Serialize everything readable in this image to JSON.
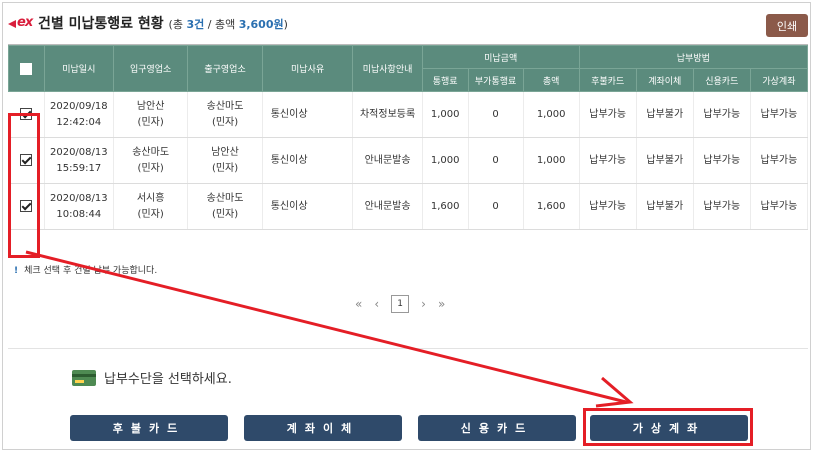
{
  "header": {
    "title": "건별 미납통행료 현황",
    "summary_prefix": "(총 ",
    "count": "3건",
    "summary_mid": " / 총액 ",
    "total": "3,600원",
    "summary_suffix": ")",
    "print_label": "인쇄"
  },
  "table": {
    "headers": {
      "date": "미납일시",
      "entry": "입구영업소",
      "exit": "출구영업소",
      "reason": "미납사유",
      "guide": "미납사항안내",
      "amount_group": "미납금액",
      "method_group": "납부방법",
      "toll": "통행료",
      "surcharge": "부가통행료",
      "total": "총액",
      "postpaid": "후불카드",
      "transfer": "계좌이체",
      "credit": "신용카드",
      "virtual": "가상계좌"
    },
    "rows": [
      {
        "date": "2020/09/18",
        "time": "12:42:04",
        "entry": "남안산",
        "entry_sub": "(민자)",
        "exit": "송산마도",
        "exit_sub": "(민자)",
        "reason": "통신이상",
        "guide": "차적정보등록",
        "toll": "1,000",
        "surcharge": "0",
        "total": "1,000",
        "postpaid": "납부가능",
        "transfer": "납부불가",
        "credit": "납부가능",
        "virtual": "납부가능",
        "checked": true
      },
      {
        "date": "2020/08/13",
        "time": "15:59:17",
        "entry": "송산마도",
        "entry_sub": "(민자)",
        "exit": "남안산",
        "exit_sub": "(민자)",
        "reason": "통신이상",
        "guide": "안내문발송",
        "toll": "1,000",
        "surcharge": "0",
        "total": "1,000",
        "postpaid": "납부가능",
        "transfer": "납부불가",
        "credit": "납부가능",
        "virtual": "납부가능",
        "checked": true
      },
      {
        "date": "2020/08/13",
        "time": "10:08:44",
        "entry": "서시흥",
        "entry_sub": "(민자)",
        "exit": "송산마도",
        "exit_sub": "(민자)",
        "reason": "통신이상",
        "guide": "안내문발송",
        "toll": "1,600",
        "surcharge": "0",
        "total": "1,600",
        "postpaid": "납부가능",
        "transfer": "납부불가",
        "credit": "납부가능",
        "virtual": "납부가능",
        "checked": true
      }
    ]
  },
  "note": "체크 선택 후 건별 납부 가능합니다.",
  "pager": {
    "first": "«",
    "prev": "‹",
    "current": "1",
    "next": "›",
    "last": "»"
  },
  "payment": {
    "label": "납부수단을 선택하세요.",
    "buttons": [
      "후불카드",
      "계좌이체",
      "신용카드",
      "가상계좌"
    ]
  },
  "colors": {
    "header_bg": "#5b8b7d",
    "button_bg": "#2f4a6a",
    "annotation": "#e41e26",
    "print_bg": "#8b5a4a"
  }
}
